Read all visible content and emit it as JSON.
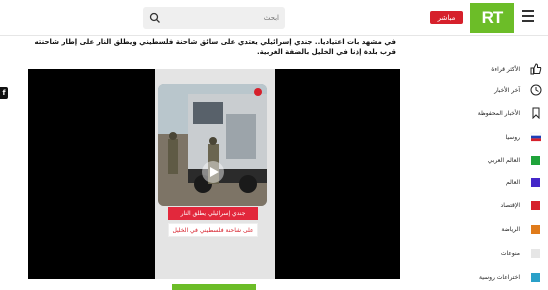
{
  "header": {
    "live_label": "مباشر",
    "logo_text": "RT",
    "search_placeholder": "ابحث"
  },
  "sidebar": {
    "items": [
      {
        "label": "الأكثر قراءة",
        "icon": "thumbs-up-icon"
      },
      {
        "label": "آخر الأخبار",
        "icon": "clock-icon"
      },
      {
        "label": "الأخبار المحفوظة",
        "icon": "bookmark-icon"
      },
      {
        "label": "روسيا",
        "icon": "russia-flag-icon"
      },
      {
        "label": "العالم العربي",
        "color": "#1fa33a"
      },
      {
        "label": "العالم",
        "color": "#4427c9"
      },
      {
        "label": "الإقتصاد",
        "color": "#d6202b"
      },
      {
        "label": "الرياضة",
        "color": "#e07b1a"
      },
      {
        "label": "منوعات",
        "color": "#e6e6e6"
      },
      {
        "label": "اختراعات روسية",
        "color": "#2aa0c8"
      }
    ]
  },
  "article": {
    "text": "في مشهد بات اعتياديا.. جندي إسرائيلي يعتدي على سائق شاحنة فلسطيني ويطلق النار على إطار شاحنته قرب بلدة إذنا في الخليل بالضفة الغربية."
  },
  "video": {
    "caption_line1": "جندي إسرائيلي يطلق النار",
    "caption_line2": "على شاحنة فلسطيني في الخليل"
  },
  "edge_icon_text": "f",
  "colors": {
    "brand_green": "#6cbd28",
    "live_red": "#d6202b"
  }
}
